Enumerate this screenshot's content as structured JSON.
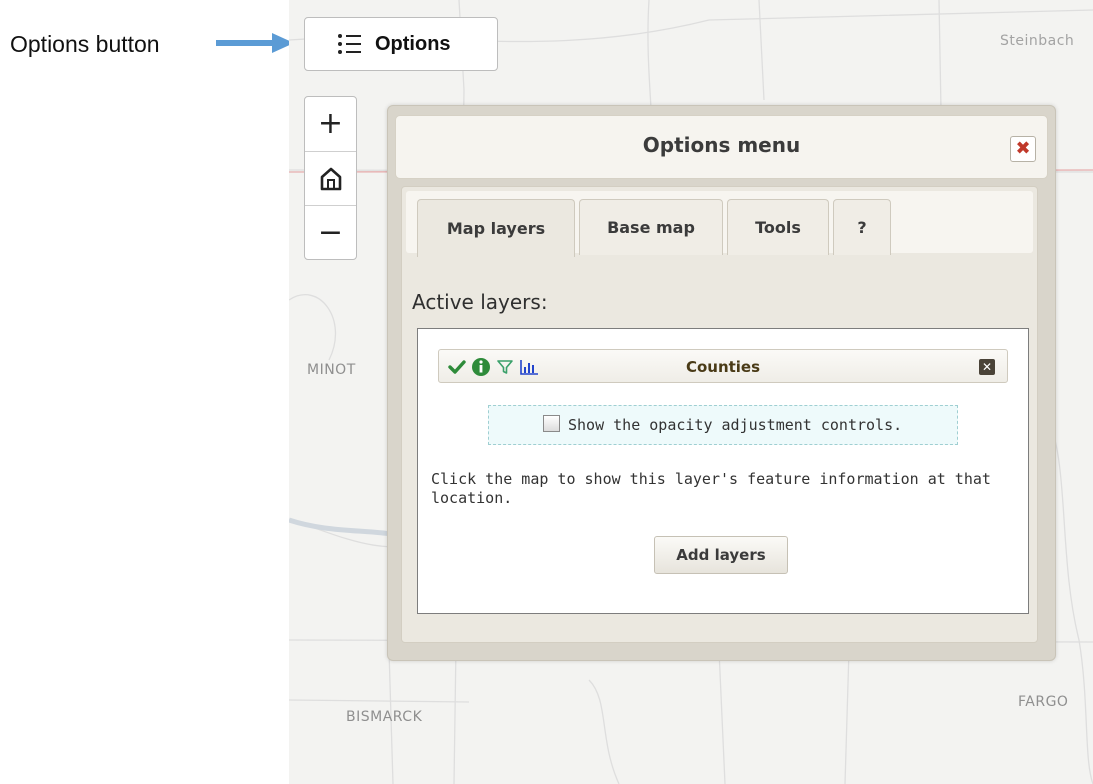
{
  "annotation": {
    "label": "Options button",
    "arrow_color": "#5b9bd5"
  },
  "map": {
    "cities": {
      "steinbach": "Steinbach",
      "minot": "MINOT",
      "bismarck": "BISMARCK",
      "fargo": "FARGO"
    }
  },
  "options_button": {
    "icon": "list-icon",
    "label": "Options"
  },
  "zoom": {
    "zoom_in": {
      "icon": "plus-icon",
      "label": "+"
    },
    "home": {
      "icon": "home-icon"
    },
    "zoom_out": {
      "icon": "minus-icon",
      "label": "−"
    }
  },
  "panel": {
    "title": "Options menu",
    "close": {
      "icon": "close-icon",
      "label": "✖",
      "color": "#c0392b"
    },
    "tabs": [
      {
        "label": "Map layers",
        "active": true
      },
      {
        "label": "Base map",
        "active": false
      },
      {
        "label": "Tools",
        "active": false
      },
      {
        "label": "?",
        "active": false
      }
    ],
    "section_title": "Active layers:",
    "layer": {
      "name": "Counties",
      "icons": [
        "check-icon",
        "info-icon",
        "filter-icon",
        "bar-chart-icon"
      ],
      "remove": {
        "icon": "remove-icon",
        "label": "✕"
      }
    },
    "opacity": {
      "checked": false,
      "label": "Show the opacity adjustment controls."
    },
    "info_text": "Click the map to show this layer's feature information at that location.",
    "add_layers": "Add layers"
  },
  "colors": {
    "check": "#2e8b3a",
    "info": "#2e8b3a",
    "filter": "#3aa06a",
    "chart": "#2244cc"
  }
}
